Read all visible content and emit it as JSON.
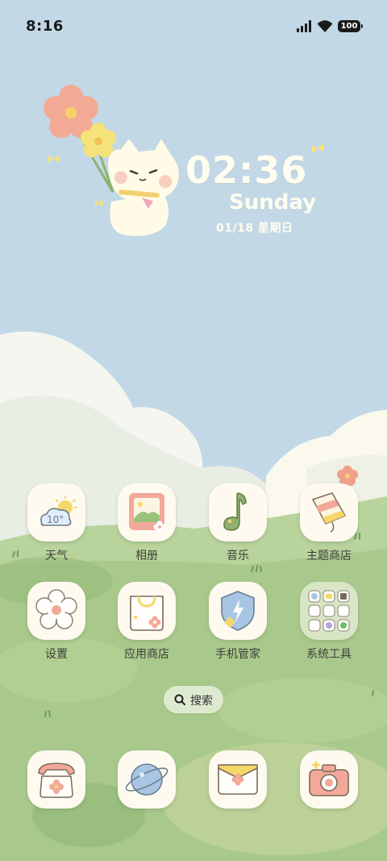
{
  "status_bar": {
    "time": "8:16",
    "battery": "100"
  },
  "widget": {
    "time": "02:36",
    "day": "Sunday",
    "date": "01/18 星期日"
  },
  "apps": [
    {
      "label": "天气",
      "icon": "weather-icon"
    },
    {
      "label": "相册",
      "icon": "gallery-icon"
    },
    {
      "label": "音乐",
      "icon": "music-icon"
    },
    {
      "label": "主题商店",
      "icon": "theme-store-icon"
    },
    {
      "label": "设置",
      "icon": "settings-icon"
    },
    {
      "label": "应用商店",
      "icon": "app-store-icon"
    },
    {
      "label": "手机管家",
      "icon": "phone-manager-icon"
    },
    {
      "label": "系统工具",
      "icon": "system-tools-folder-icon"
    }
  ],
  "weather_icon_text": "10°",
  "search": {
    "label": "搜索"
  },
  "dock": [
    {
      "icon": "phone-icon"
    },
    {
      "icon": "browser-icon"
    },
    {
      "icon": "messages-icon"
    },
    {
      "icon": "camera-icon"
    }
  ],
  "colors": {
    "sky": "#c2d8e6",
    "grass": "#a9c98c",
    "tile": "#fffaf0",
    "text": "#3c3f3a"
  }
}
